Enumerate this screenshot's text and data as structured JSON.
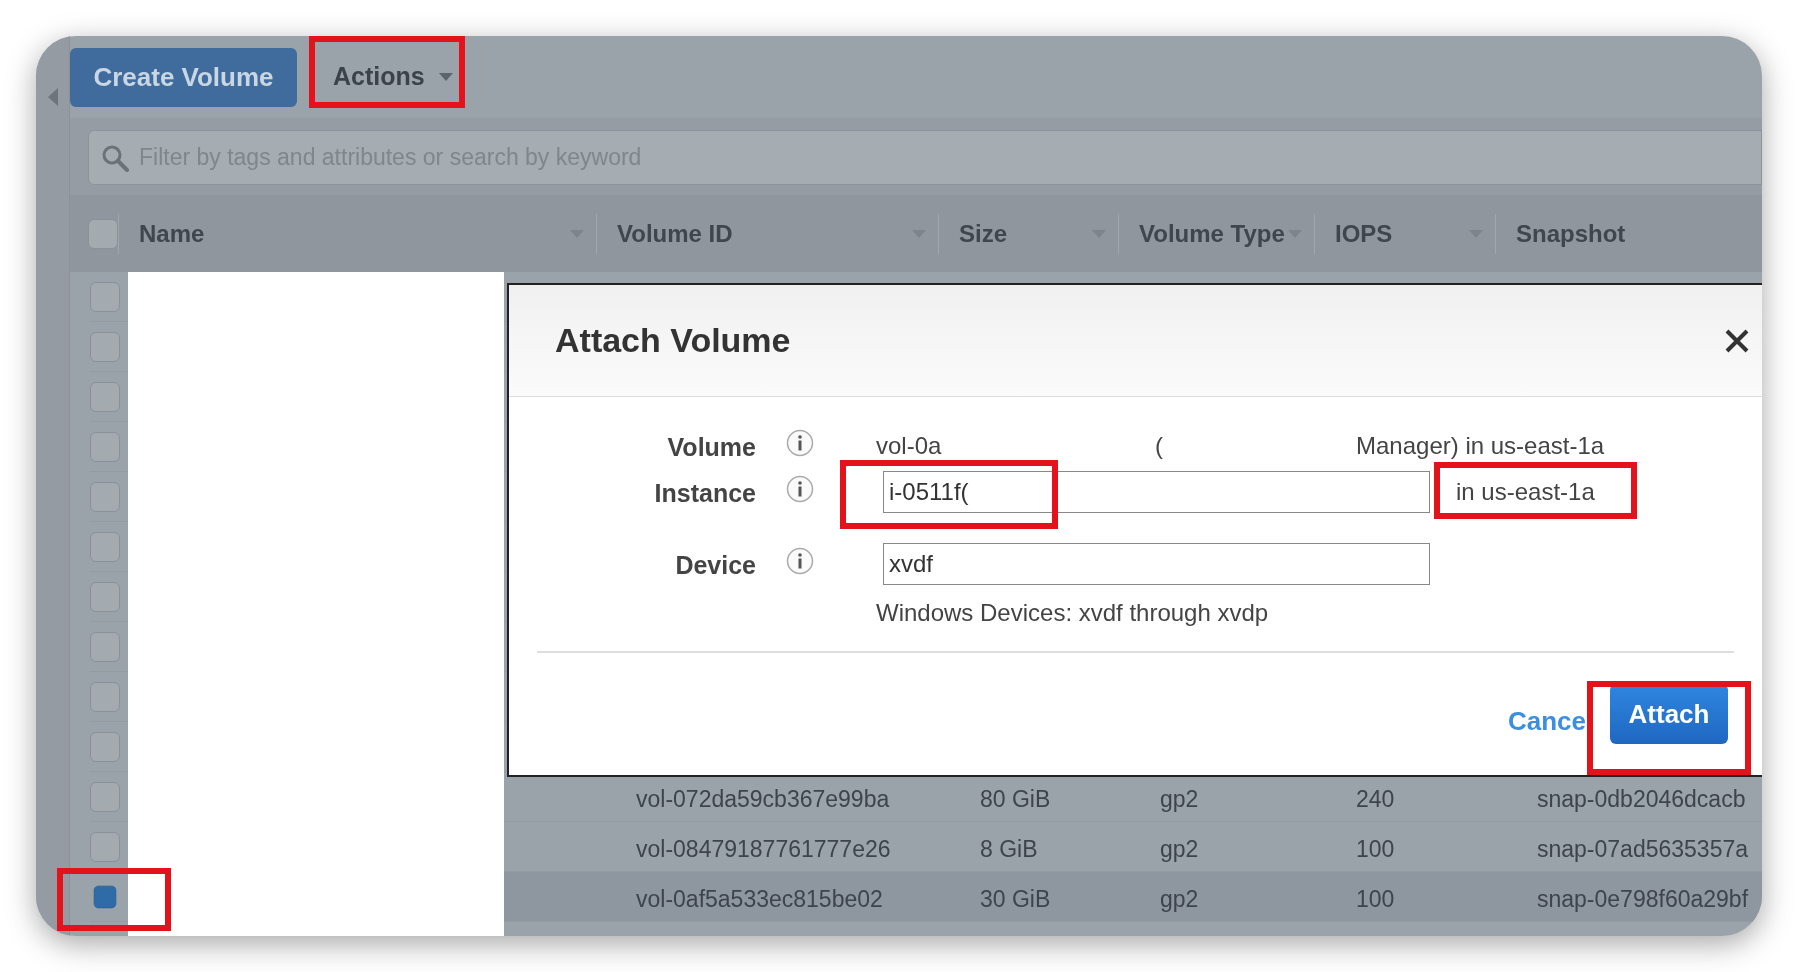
{
  "toolbar": {
    "create_button": "Create Volume",
    "actions_button": "Actions"
  },
  "filter": {
    "placeholder": "Filter by tags and attributes or search by keyword"
  },
  "table": {
    "select_all": {
      "checked": false
    },
    "columns": [
      "Name",
      "Volume ID",
      "Size",
      "Volume Type",
      "IOPS",
      "Snapshot"
    ],
    "rows": [
      {
        "checked": false
      },
      {
        "checked": false
      },
      {
        "checked": false
      },
      {
        "checked": false
      },
      {
        "checked": false
      },
      {
        "checked": false
      },
      {
        "checked": false
      },
      {
        "checked": false
      },
      {
        "checked": false
      },
      {
        "checked": false
      },
      {
        "checked": false,
        "cells": [
          "vol-072da59cb367e99ba",
          "80 GiB",
          "gp2",
          "240",
          "snap-0db2046dcacb"
        ]
      },
      {
        "checked": false,
        "cells": [
          "vol-08479187761777e26",
          "8 GiB",
          "gp2",
          "100",
          "snap-07ad5635357a"
        ]
      },
      {
        "checked": true,
        "cells": [
          "vol-0af5a533ec815be02",
          "30 GiB",
          "gp2",
          "100",
          "snap-0e798f60a29bf"
        ]
      }
    ]
  },
  "modal": {
    "title": "Attach Volume",
    "fields": [
      {
        "kind": "text",
        "label": "Volume",
        "parts": [
          "vol-0a",
          "(",
          "Manager) in us-east-1a"
        ]
      },
      {
        "kind": "input",
        "label": "Instance",
        "value": "i-0511f(",
        "suffix": "in us-east-1a"
      },
      {
        "kind": "input",
        "label": "Device",
        "value": "xvdf",
        "hint": "Windows Devices: xvdf through xvdp"
      }
    ],
    "cancel": "Cance",
    "confirm": "Attach"
  }
}
